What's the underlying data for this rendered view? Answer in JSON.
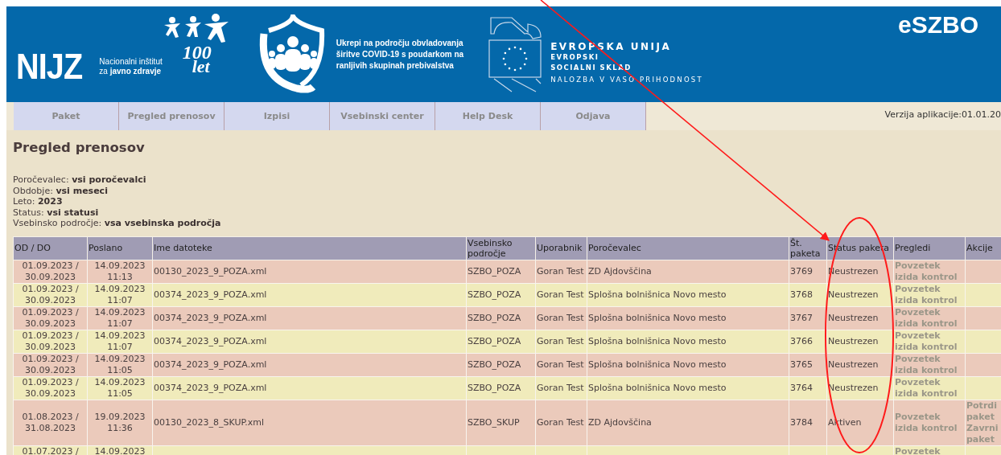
{
  "banner": {
    "nijz_logo": "NIJZ",
    "nijz_name": [
      "Nacionalni inštitut",
      "za **javno zdravje**"
    ],
    "anniversary": [
      "100",
      "let"
    ],
    "covid_text": [
      "Ukrepi na področju obvladovanja",
      "širitve COVID-19 s poudarkom na",
      "ranljivih skupinah prebivalstva"
    ],
    "eu_title": "EVROPSKA UNIJA",
    "eu_fund": [
      "EVROPSKI",
      "SOCIALNI SKLAD"
    ],
    "eu_slogan": "NALOZBA V VASO PRIHODNOST",
    "app_name": "eSZBO"
  },
  "tabs": [
    "Paket",
    "Pregled prenosov",
    "Izpisi",
    "Vsebinski center",
    "Help Desk",
    "Odjava"
  ],
  "version": "Verzija aplikacije:01.01.20",
  "page_title": "Pregled prenosov",
  "filters": [
    {
      "label": "Poročevalec:",
      "value": "vsi poročevalci"
    },
    {
      "label": "Obdobje:",
      "value": "vsi meseci"
    },
    {
      "label": "Leto:",
      "value": "2023"
    },
    {
      "label": "Status:",
      "value": "vsi statusi"
    },
    {
      "label": "Vsebinsko področje:",
      "value": "vsa vsebinska področja"
    }
  ],
  "table": {
    "columns": [
      "OD / DO",
      "Poslano",
      "Ime datoteke",
      "Vsebinsko področje",
      "Uporabnik",
      "Poročevalec",
      "Št. paketa",
      "Status paketa",
      "Pregledi",
      "Akcije"
    ],
    "rows": [
      {
        "od_do": [
          "01.09.2023 /",
          "30.09.2023"
        ],
        "poslano": [
          "14.09.2023",
          "11:13"
        ],
        "file": "00130_2023_9_POZA.xml",
        "area": "SZBO_POZA",
        "user": "Goran Test",
        "reporter": "ZD Ajdovščina",
        "package": "3769",
        "status": "Neustrezen",
        "reviews": "Povzetek izida kontrol",
        "actions": []
      },
      {
        "od_do": [
          "01.09.2023 /",
          "30.09.2023"
        ],
        "poslano": [
          "14.09.2023",
          "11:07"
        ],
        "file": "00374_2023_9_POZA.xml",
        "area": "SZBO_POZA",
        "user": "Goran Test",
        "reporter": "Splošna bolnišnica Novo mesto",
        "package": "3768",
        "status": "Neustrezen",
        "reviews": "Povzetek izida kontrol",
        "actions": []
      },
      {
        "od_do": [
          "01.09.2023 /",
          "30.09.2023"
        ],
        "poslano": [
          "14.09.2023",
          "11:07"
        ],
        "file": "00374_2023_9_POZA.xml",
        "area": "SZBO_POZA",
        "user": "Goran Test",
        "reporter": "Splošna bolnišnica Novo mesto",
        "package": "3767",
        "status": "Neustrezen",
        "reviews": "Povzetek izida kontrol",
        "actions": []
      },
      {
        "od_do": [
          "01.09.2023 /",
          "30.09.2023"
        ],
        "poslano": [
          "14.09.2023",
          "11:07"
        ],
        "file": "00374_2023_9_POZA.xml",
        "area": "SZBO_POZA",
        "user": "Goran Test",
        "reporter": "Splošna bolnišnica Novo mesto",
        "package": "3766",
        "status": "Neustrezen",
        "reviews": "Povzetek izida kontrol",
        "actions": []
      },
      {
        "od_do": [
          "01.09.2023 /",
          "30.09.2023"
        ],
        "poslano": [
          "14.09.2023",
          "11:05"
        ],
        "file": "00374_2023_9_POZA.xml",
        "area": "SZBO_POZA",
        "user": "Goran Test",
        "reporter": "Splošna bolnišnica Novo mesto",
        "package": "3765",
        "status": "Neustrezen",
        "reviews": "Povzetek izida kontrol",
        "actions": []
      },
      {
        "od_do": [
          "01.09.2023 /",
          "30.09.2023"
        ],
        "poslano": [
          "14.09.2023",
          "11:05"
        ],
        "file": "00374_2023_9_POZA.xml",
        "area": "SZBO_POZA",
        "user": "Goran Test",
        "reporter": "Splošna bolnišnica Novo mesto",
        "package": "3764",
        "status": "Neustrezen",
        "reviews": "Povzetek izida kontrol",
        "actions": []
      },
      {
        "od_do": [
          "01.08.2023 /",
          "31.08.2023"
        ],
        "poslano": [
          "19.09.2023",
          "11:36"
        ],
        "file": "00130_2023_8_SKUP.xml",
        "area": "SZBO_SKUP",
        "user": "Goran Test",
        "reporter": "ZD Ajdovščina",
        "package": "3784",
        "status": "Aktiven",
        "reviews": "Povzetek izida kontrol",
        "actions": [
          "Potrdi paket",
          "Zavrni paket"
        ]
      },
      {
        "od_do": [
          "01.07.2023 /"
        ],
        "poslano": [
          "14.09.2023"
        ],
        "file": "",
        "area": "",
        "user": "",
        "reporter": "",
        "package": "",
        "status": "",
        "reviews": "Povzetek",
        "actions": []
      }
    ]
  }
}
